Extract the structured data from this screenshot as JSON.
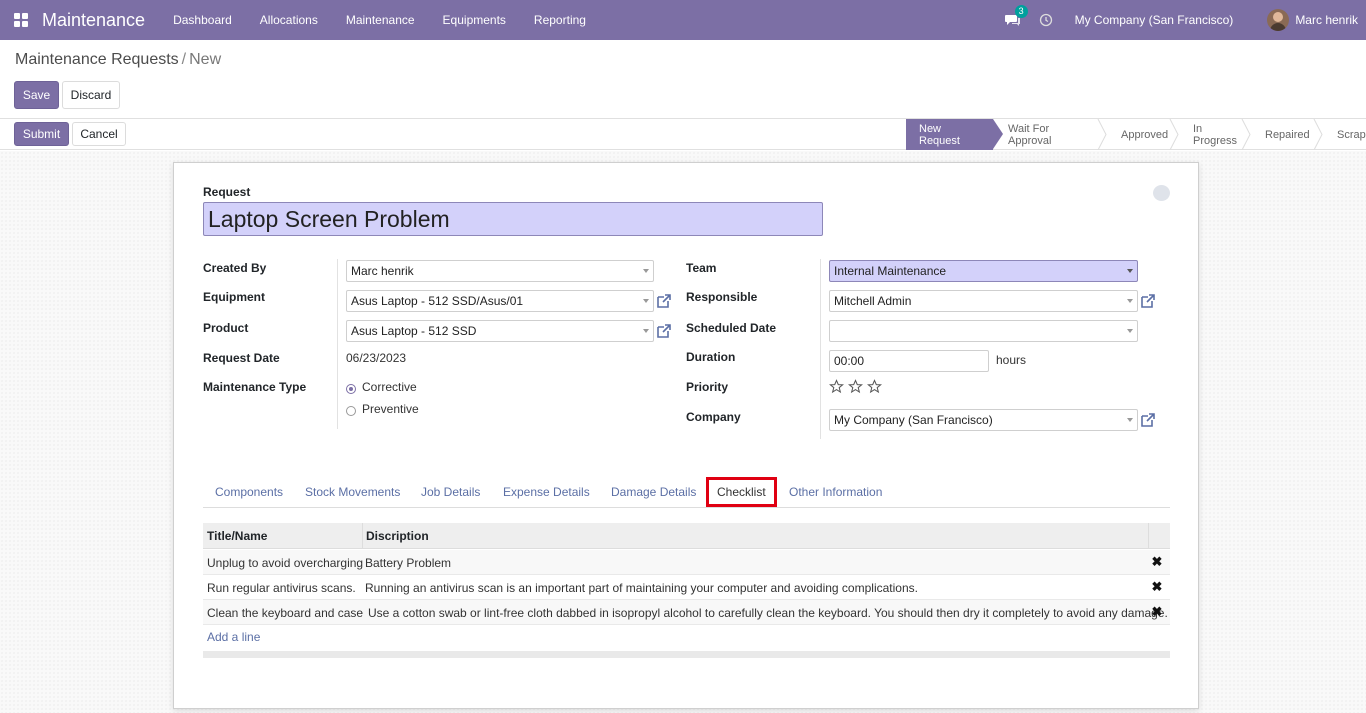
{
  "navbar": {
    "brand": "Maintenance",
    "menu": [
      "Dashboard",
      "Allocations",
      "Maintenance",
      "Equipments",
      "Reporting"
    ],
    "chat_count": "3",
    "company": "My Company (San Francisco)",
    "user": "Marc henrik",
    "bg_color": "#7c6fa5"
  },
  "breadcrumb": {
    "parent": "Maintenance Requests",
    "separator": "/",
    "current": "New"
  },
  "actions": {
    "save": "Save",
    "discard": "Discard",
    "submit": "Submit",
    "cancel": "Cancel"
  },
  "stages": [
    "New Request",
    "Wait For Approval",
    "Approved",
    "In Progress",
    "Repaired",
    "Scrap"
  ],
  "active_stage": "New Request",
  "form": {
    "request_label": "Request",
    "request_title": "Laptop Screen Problem",
    "left": {
      "created_by_label": "Created By",
      "created_by": "Marc henrik",
      "equipment_label": "Equipment",
      "equipment": "Asus Laptop - 512 SSD/Asus/01",
      "product_label": "Product",
      "product": "Asus Laptop - 512 SSD",
      "request_date_label": "Request Date",
      "request_date": "06/23/2023",
      "maintenance_type_label": "Maintenance Type",
      "maintenance_types": [
        "Corrective",
        "Preventive"
      ],
      "maintenance_type_selected": "Corrective"
    },
    "right": {
      "team_label": "Team",
      "team": "Internal Maintenance",
      "responsible_label": "Responsible",
      "responsible": "Mitchell Admin",
      "scheduled_date_label": "Scheduled Date",
      "scheduled_date": "",
      "duration_label": "Duration",
      "duration": "00:00",
      "duration_unit": "hours",
      "priority_label": "Priority",
      "priority_stars": 0,
      "priority_max": 3,
      "company_label": "Company",
      "company": "My Company (San Francisco)"
    }
  },
  "tabs": [
    "Components",
    "Stock Movements",
    "Job Details",
    "Expense Details",
    "Damage Details",
    "Checklist",
    "Other Information"
  ],
  "active_tab": "Checklist",
  "checklist": {
    "columns": [
      "Title/Name",
      "Discription"
    ],
    "rows": [
      {
        "title": "Unplug to avoid overcharging",
        "description": "Battery Problem"
      },
      {
        "title": "Run regular antivirus scans.",
        "description": "Running an antivirus scan is an important part of maintaining your computer and avoiding complications."
      },
      {
        "title": "Clean the keyboard and case",
        "description": "Use a cotton swab or lint-free cloth dabbed in isopropyl alcohol to carefully clean the keyboard. You should then dry it completely to avoid any damage."
      }
    ],
    "add_line": "Add a line"
  }
}
